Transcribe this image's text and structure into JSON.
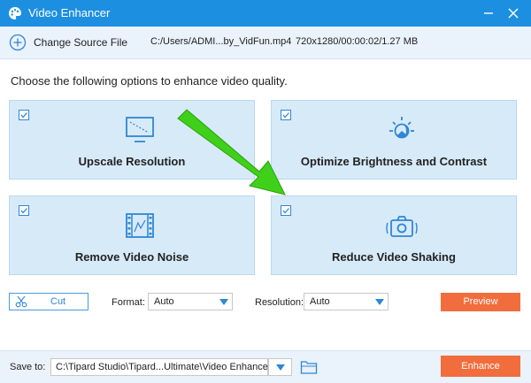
{
  "window": {
    "title": "Video Enhancer",
    "app_icon": "palette-icon",
    "controls": [
      "minimize-icon",
      "close-icon"
    ]
  },
  "source": {
    "change_label": "Change Source File",
    "file_path": "C:/Users/ADMI...by_VidFun.mp4",
    "file_info": "720x1280/00:00:02/1.27 MB"
  },
  "instruction": "Choose the following options to enhance video quality.",
  "options": [
    {
      "label": "Upscale Resolution",
      "icon": "monitor-icon",
      "checked": true
    },
    {
      "label": "Optimize Brightness and Contrast",
      "icon": "brightness-icon",
      "checked": true
    },
    {
      "label": "Remove Video Noise",
      "icon": "film-icon",
      "checked": true
    },
    {
      "label": "Reduce Video Shaking",
      "icon": "camera-shake-icon",
      "checked": true
    }
  ],
  "controls": {
    "cut_label": "Cut",
    "format_label": "Format:",
    "format_value": "Auto",
    "resolution_label": "Resolution:",
    "resolution_value": "Auto",
    "preview_label": "Preview"
  },
  "save": {
    "label": "Save to:",
    "path": "C:\\Tipard Studio\\Tipard...Ultimate\\Video Enhancer",
    "enhance_label": "Enhance"
  },
  "colors": {
    "titlebar": "#1d8fe0",
    "accent": "#2f86d6",
    "card": "#d7eaf8",
    "action": "#f26d3d",
    "arrow": "#3fd01a"
  }
}
